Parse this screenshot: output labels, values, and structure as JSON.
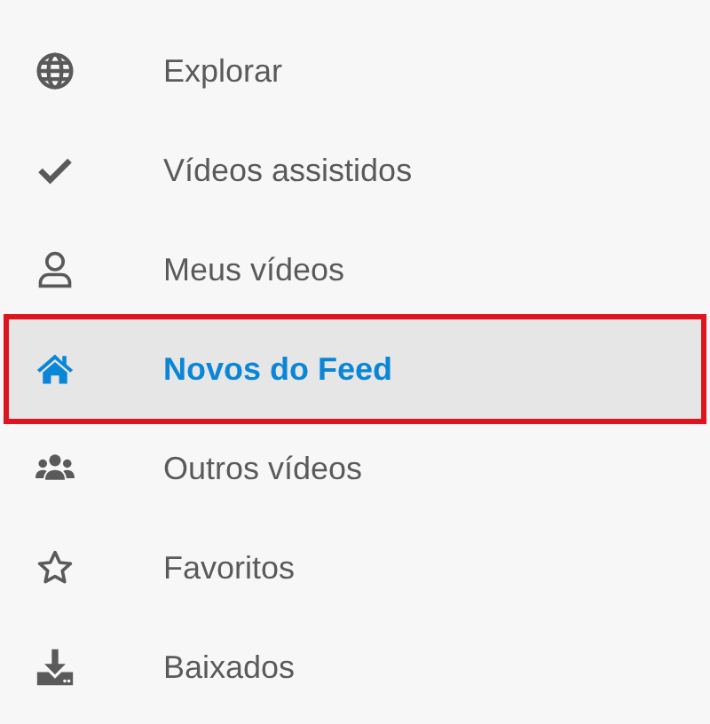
{
  "menu": {
    "items": [
      {
        "kind": "globe",
        "label": "Explorar",
        "selected": false
      },
      {
        "kind": "check",
        "label": "Vídeos assistidos",
        "selected": false
      },
      {
        "kind": "user",
        "label": "Meus vídeos",
        "selected": false
      },
      {
        "kind": "home",
        "label": "Novos do Feed",
        "selected": true
      },
      {
        "kind": "users",
        "label": "Outros vídeos",
        "selected": false
      },
      {
        "kind": "star",
        "label": "Favoritos",
        "selected": false
      },
      {
        "kind": "download",
        "label": "Baixados",
        "selected": false
      }
    ]
  }
}
